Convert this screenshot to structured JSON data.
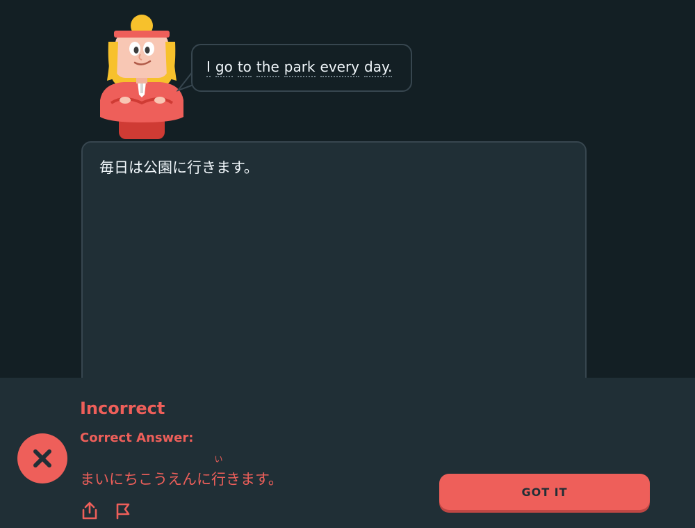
{
  "prompt": {
    "words": [
      "I",
      "go",
      "to",
      "the",
      "park",
      "every",
      "day."
    ]
  },
  "answer": {
    "value": "毎日は公園に行きます。"
  },
  "feedback": {
    "title": "Incorrect",
    "subtitle": "Correct Answer:",
    "correct_before": "まいにちこうえんに",
    "correct_ruby_base": "行",
    "correct_ruby_reading": "い",
    "correct_after": "きます。",
    "continue_label": "GOT IT"
  },
  "icons": {
    "status": "x-icon",
    "share": "share-icon",
    "report": "flag-icon"
  },
  "colors": {
    "error": "#ee5f5a",
    "background": "#131f24",
    "panel": "#202f36",
    "border": "#37464f"
  }
}
